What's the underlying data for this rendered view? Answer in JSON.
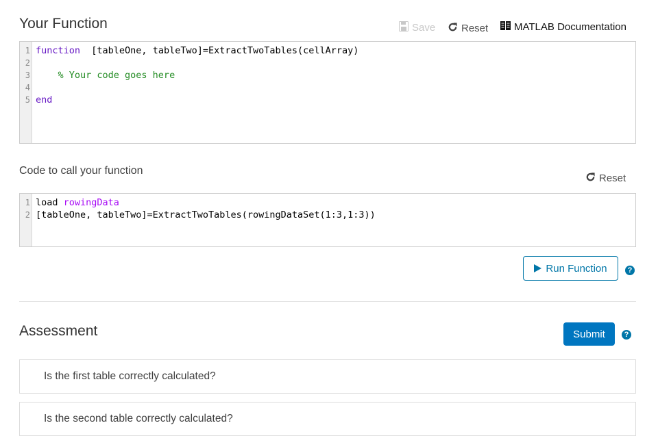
{
  "function_section": {
    "title": "Your Function",
    "toolbar": {
      "save_label": "Save",
      "reset_label": "Reset",
      "doc_label": "MATLAB Documentation"
    },
    "editor": {
      "line_numbers": [
        "1",
        "2",
        "3",
        "4",
        "5"
      ],
      "lines": [
        {
          "keyword": "function",
          "text": "  [tableOne, tableTwo]=ExtractTwoTables(cellArray)"
        },
        {
          "text": ""
        },
        {
          "comment": "    % Your code goes here"
        },
        {
          "text": ""
        },
        {
          "keyword": "end"
        }
      ]
    }
  },
  "call_section": {
    "title": "Code to call your function",
    "reset_label": "Reset",
    "editor": {
      "line_numbers": [
        "1",
        "2"
      ],
      "lines": [
        {
          "text": "load ",
          "string": "rowingData"
        },
        {
          "text": "[tableOne, tableTwo]=ExtractTwoTables(rowingDataSet(1:3,1:3))"
        }
      ]
    },
    "run_label": "Run Function",
    "help_icon": "?"
  },
  "assessment": {
    "title": "Assessment",
    "submit_label": "Submit",
    "help_icon": "?",
    "items": [
      {
        "label": "Is the first table correctly calculated?"
      },
      {
        "label": "Is the second table correctly calculated?"
      }
    ]
  },
  "colors": {
    "accent": "#0076a8",
    "submit_bg": "#0076c0",
    "keyword": "#6618c4",
    "comment": "#228b22",
    "string": "#a709f5"
  }
}
